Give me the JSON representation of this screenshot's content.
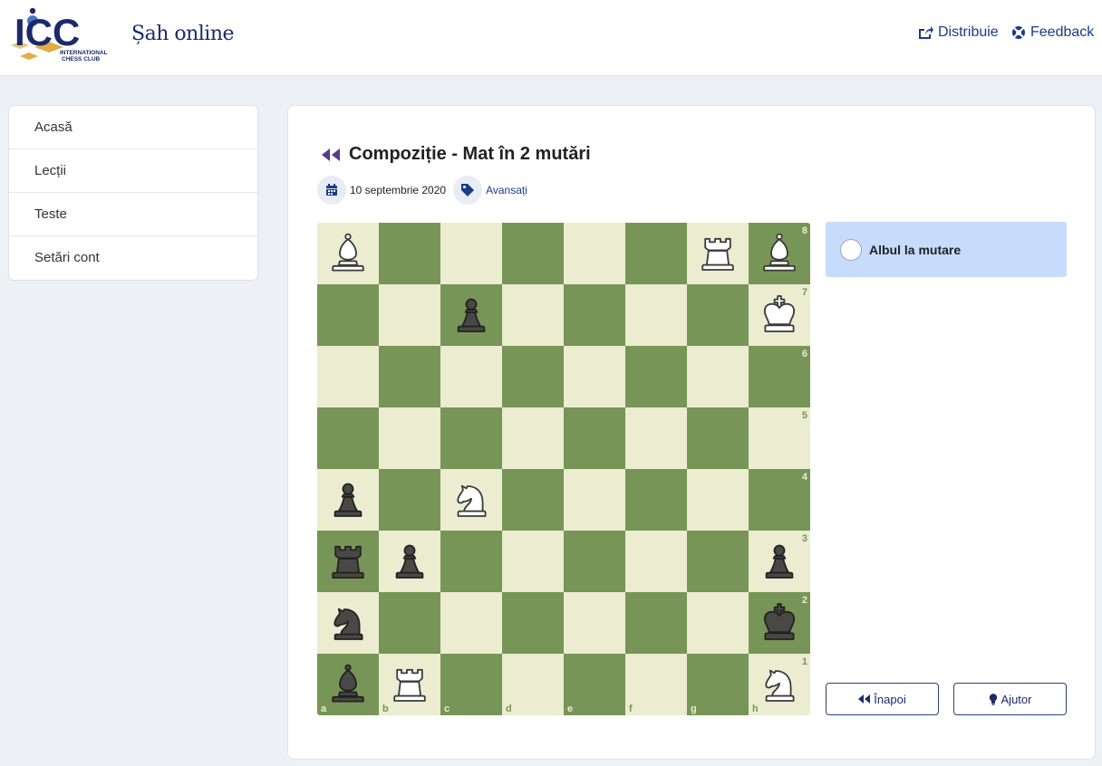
{
  "header": {
    "logo_text": "ICC",
    "logo_subtext_1": "INTERNATIONAL",
    "logo_subtext_2": "CHESS CLUB",
    "site_title": "Șah online",
    "share_label": "Distribuie",
    "feedback_label": "Feedback",
    "brand_color": "#1c2a6a",
    "accent_gold": "#e0ac45"
  },
  "sidebar": {
    "items": [
      {
        "label": "Acasă"
      },
      {
        "label": "Lecții"
      },
      {
        "label": "Teste"
      },
      {
        "label": "Setări cont"
      }
    ]
  },
  "puzzle": {
    "title": "Compoziție - Mat în 2 mutări",
    "date": "10 septembrie 2020",
    "level": "Avansați",
    "turn_text": "Albul la mutare",
    "back_label": "Înapoi",
    "help_label": "Ajutor"
  },
  "board": {
    "light_color": "#ebecd0",
    "dark_color": "#779556",
    "files": [
      "a",
      "b",
      "c",
      "d",
      "e",
      "f",
      "g",
      "h"
    ],
    "ranks": [
      "8",
      "7",
      "6",
      "5",
      "4",
      "3",
      "2",
      "1"
    ],
    "pieces": [
      {
        "square": "a8",
        "color": "white",
        "type": "bishop"
      },
      {
        "square": "g8",
        "color": "white",
        "type": "rook"
      },
      {
        "square": "h8",
        "color": "white",
        "type": "bishop"
      },
      {
        "square": "c7",
        "color": "black",
        "type": "pawn"
      },
      {
        "square": "h7",
        "color": "white",
        "type": "king"
      },
      {
        "square": "a4",
        "color": "black",
        "type": "pawn"
      },
      {
        "square": "c4",
        "color": "white",
        "type": "knight"
      },
      {
        "square": "a3",
        "color": "black",
        "type": "rook"
      },
      {
        "square": "b3",
        "color": "black",
        "type": "pawn"
      },
      {
        "square": "h3",
        "color": "black",
        "type": "pawn"
      },
      {
        "square": "a2",
        "color": "black",
        "type": "knight"
      },
      {
        "square": "h2",
        "color": "black",
        "type": "king"
      },
      {
        "square": "a1",
        "color": "black",
        "type": "bishop"
      },
      {
        "square": "b1",
        "color": "white",
        "type": "rook"
      },
      {
        "square": "h1",
        "color": "white",
        "type": "knight"
      }
    ]
  }
}
